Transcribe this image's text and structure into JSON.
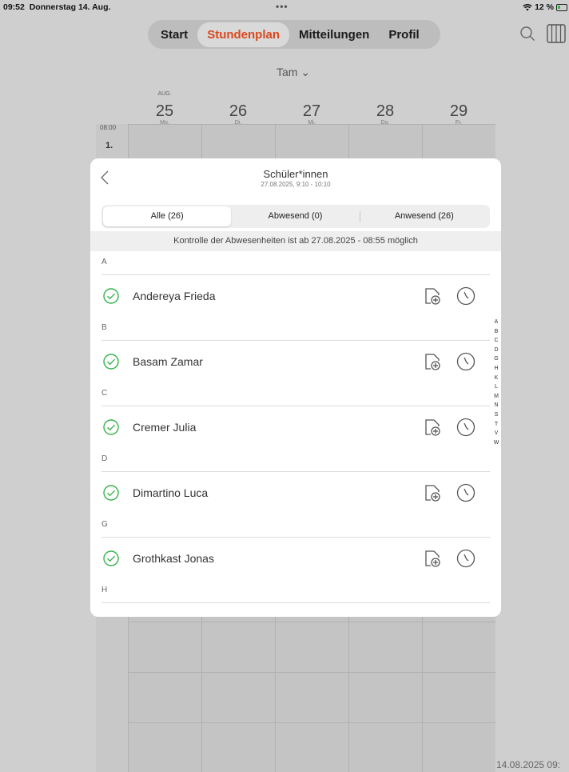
{
  "status_bar": {
    "time": "09:52",
    "date": "Donnerstag 14. Aug.",
    "dots": "•••",
    "battery": "12 %"
  },
  "nav": {
    "tabs": [
      {
        "label": "Start",
        "active": false
      },
      {
        "label": "Stundenplan",
        "active": true
      },
      {
        "label": "Mitteilungen",
        "active": false
      },
      {
        "label": "Profil",
        "active": false
      }
    ],
    "icons": [
      "search-icon",
      "columns-icon"
    ]
  },
  "class_selector": "Tam ⌄",
  "calendar": {
    "month": "AUG.",
    "days": [
      {
        "num": "25",
        "dow": "Mo."
      },
      {
        "num": "26",
        "dow": "Di."
      },
      {
        "num": "27",
        "dow": "Mi."
      },
      {
        "num": "28",
        "dow": "Do."
      },
      {
        "num": "29",
        "dow": "Fr."
      }
    ],
    "start_time": "08:00",
    "first_period": "1.",
    "footer_date": "14.08.2025 09:"
  },
  "modal": {
    "title": "Schüler*innen",
    "subtitle": "27.08.2025, 9:10 - 10:10",
    "segments": [
      {
        "label": "Alle (26)",
        "active": true
      },
      {
        "label": "Abwesend (0)",
        "active": false
      },
      {
        "label": "Anwesend (26)",
        "active": false
      }
    ],
    "notice": "Kontrolle der Abwesenheiten ist ab 27.08.2025 - 08:55 möglich",
    "sections": [
      {
        "letter": "A",
        "students": [
          "Andereya Frieda"
        ]
      },
      {
        "letter": "B",
        "students": [
          "Basam Zamar"
        ]
      },
      {
        "letter": "C",
        "students": [
          "Cremer Julia"
        ]
      },
      {
        "letter": "D",
        "students": [
          "Dimartino Luca"
        ]
      },
      {
        "letter": "G",
        "students": [
          "Grothkast Jonas"
        ]
      },
      {
        "letter": "H",
        "students": []
      }
    ],
    "colors": {
      "check": "#34b34a",
      "accent": "#d9481c"
    }
  },
  "alphabet_index": [
    "A",
    "B",
    "C",
    "D",
    "G",
    "H",
    "K",
    "L",
    "M",
    "N",
    "S",
    "T",
    "V",
    "W"
  ]
}
